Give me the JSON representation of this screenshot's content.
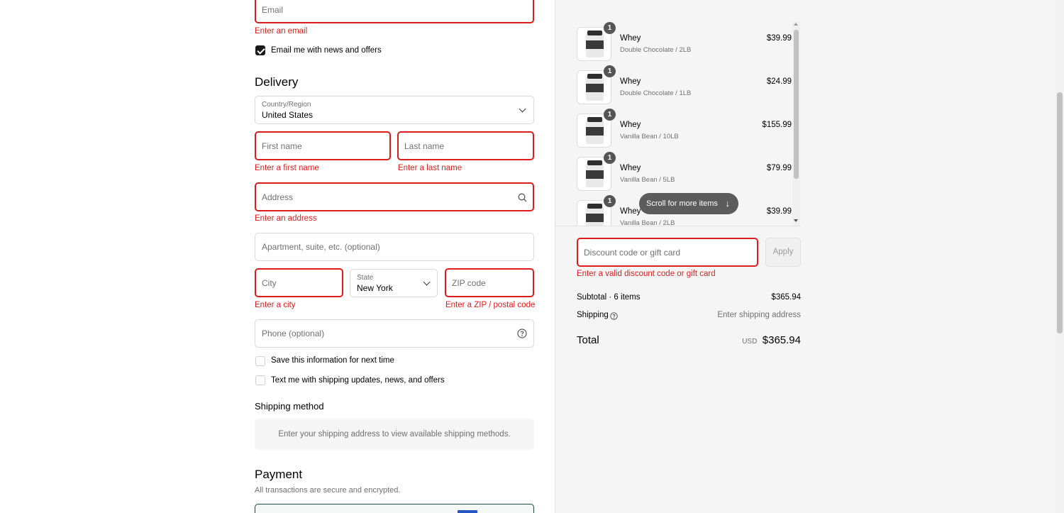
{
  "contact": {
    "email_placeholder": "Email",
    "email_error": "Enter an email",
    "newsletter_label": "Email me with news and offers"
  },
  "delivery": {
    "heading": "Delivery",
    "country_label": "Country/Region",
    "country_value": "United States",
    "first_name_placeholder": "First name",
    "first_name_error": "Enter a first name",
    "last_name_placeholder": "Last name",
    "last_name_error": "Enter a last name",
    "address_placeholder": "Address",
    "address_error": "Enter an address",
    "apartment_placeholder": "Apartment, suite, etc. (optional)",
    "city_placeholder": "City",
    "city_error": "Enter a city",
    "state_label": "State",
    "state_value": "New York",
    "zip_placeholder": "ZIP code",
    "zip_error": "Enter a ZIP / postal code",
    "phone_placeholder": "Phone (optional)",
    "save_info_label": "Save this information for next time",
    "text_me_label": "Text me with shipping updates, news, and offers"
  },
  "shipping_method": {
    "heading": "Shipping method",
    "notice": "Enter your shipping address to view available shipping methods."
  },
  "payment": {
    "heading": "Payment",
    "subtext": "All transactions are secure and encrypted."
  },
  "cart": {
    "items": [
      {
        "qty": "1",
        "name": "Whey",
        "variant": "Double Chocolate / 2LB",
        "price": "$39.99"
      },
      {
        "qty": "1",
        "name": "Whey",
        "variant": "Double Chocolate / 1LB",
        "price": "$24.99"
      },
      {
        "qty": "1",
        "name": "Whey",
        "variant": "Vanilla Bean / 10LB",
        "price": "$155.99"
      },
      {
        "qty": "1",
        "name": "Whey",
        "variant": "Vanilla Bean / 5LB",
        "price": "$79.99"
      },
      {
        "qty": "1",
        "name": "Whey",
        "variant": "Vanilla Bean / 2LB",
        "price": "$39.99"
      }
    ],
    "scroll_hint": "Scroll for more items",
    "discount_placeholder": "Discount code or gift card",
    "apply_label": "Apply",
    "discount_error": "Enter a valid discount code or gift card",
    "subtotal_label": "Subtotal · 6 items",
    "subtotal_value": "$365.94",
    "shipping_label": "Shipping",
    "shipping_value": "Enter shipping address",
    "total_label": "Total",
    "currency": "USD",
    "total_value": "$365.94"
  },
  "colors": {
    "error": "#dd1d1d",
    "summary_bg": "#f5f5f5"
  }
}
